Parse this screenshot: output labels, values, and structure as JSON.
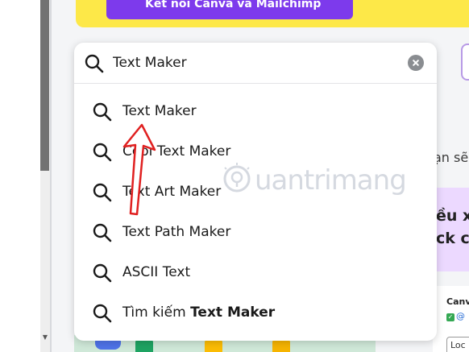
{
  "banner": {
    "button_label": "Kết nối Canva và Mailchimp"
  },
  "search": {
    "value": "Text Maker"
  },
  "suggestions": [
    {
      "label": "Text Maker"
    },
    {
      "label": "Cool Text Maker"
    },
    {
      "label": "Text Art Maker"
    },
    {
      "label": "Text Path Maker"
    },
    {
      "label": "ASCII Text"
    },
    {
      "prefix": "Tìm kiếm",
      "bold": "Text Maker"
    }
  ],
  "background": {
    "fragment_1": "ạn sẽ",
    "fragment_2_line1": "ều xe",
    "fragment_2_line2": "ck c",
    "card_title": "Canv",
    "card_handle": "@",
    "card_box": "Loc"
  },
  "watermark": {
    "text": "uantrimang"
  },
  "colors": {
    "accent_purple": "#7d3aec",
    "banner_yellow": "#fde848",
    "arrow_red": "#e02020"
  }
}
